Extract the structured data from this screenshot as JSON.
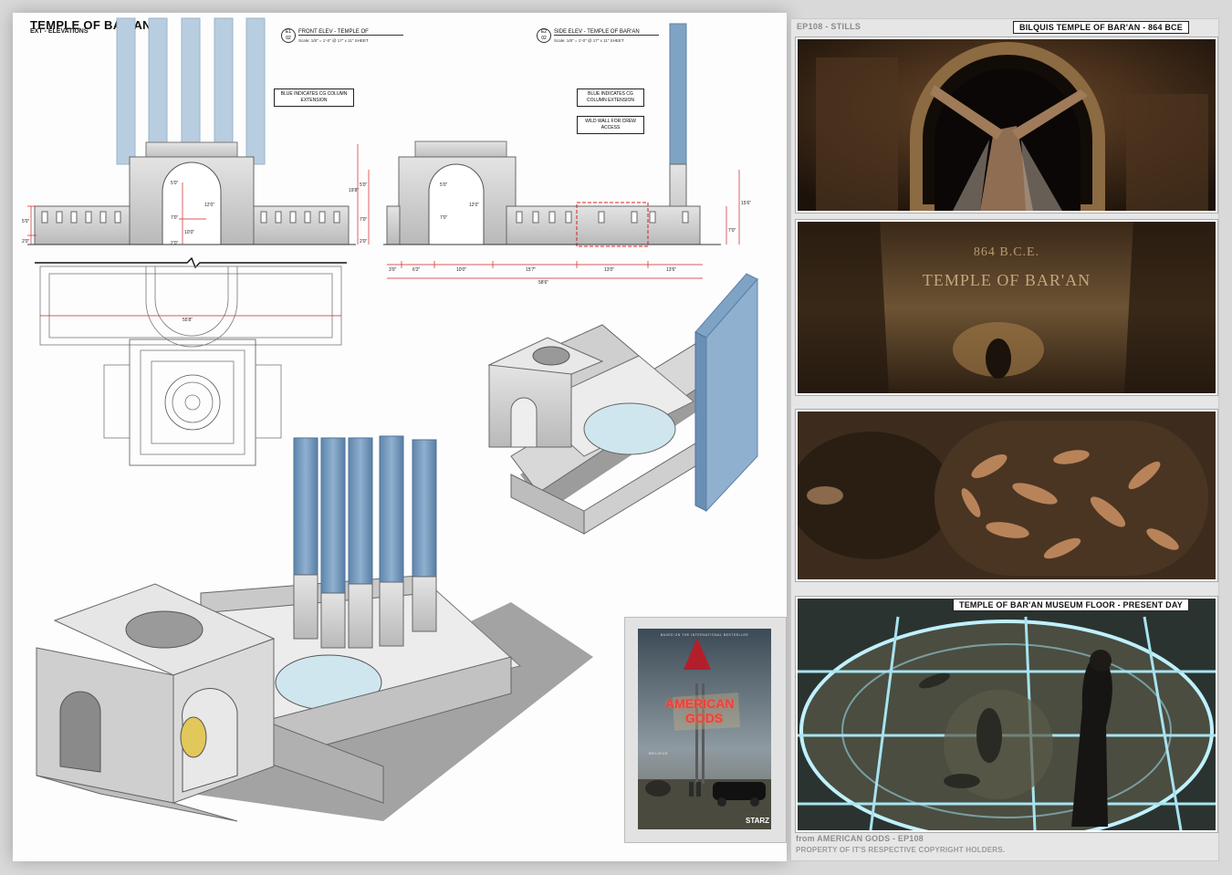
{
  "sheet": {
    "title": "TEMPLE OF BAR'AN",
    "subtitle": "EXT - ELEVATIONS",
    "front_tag": "E1",
    "front_tag_sheet": "02",
    "front_name": "FRONT ELEV - TEMPLE OF",
    "front_scale": "Scale: 1/8\" = 1'-0\" @ 17\" x 11\" SHEET",
    "side_tag": "E2",
    "side_tag_sheet": "02",
    "side_name": "SIDE ELEV - TEMPLE OF BAR'AN",
    "side_scale": "Scale: 1/8\" = 1'-0\" @ 17\" x 11\" SHEET",
    "callout_front": "BLUE INDICATES CG COLUMN EXTENSION",
    "callout_side": "BLUE INDICATES CG COLUMN EXTENSION",
    "callout_wild": "WILD WALL FOR CREW ACCESS",
    "dims_front": [
      "5'0\"",
      "2'0\"",
      "5'0\"",
      "7'0\"",
      "12'0\"",
      "10'0\"",
      "2'0\""
    ],
    "dims_side_v": [
      "19'8\"",
      "5'0\"",
      "7'0\"",
      "2'0\"",
      "5'0\"",
      "7'0\"",
      "12'0\"",
      "15'6\"",
      "7'0\""
    ],
    "dims_side_h": [
      "3'0\"",
      "6'2\"",
      "10'0\"",
      "15'7\"",
      "13'0\"",
      "13'6\""
    ],
    "dim_side_total": "58'6\"",
    "dim_plan": "55'8\"",
    "accent_blue": "#7fa3c4",
    "accent_red": "#d22222"
  },
  "stills_panel": {
    "header": "EP108 - STILLS",
    "label_top": "BILQUIS TEMPLE OF BAR'AN - 864 BCE",
    "label_bottom": "TEMPLE OF BAR'AN MUSEUM FLOOR - PRESENT DAY",
    "still2_text_date": "864 B.C.E.",
    "still2_text_name": "TEMPLE OF BAR'AN"
  },
  "poster": {
    "tagline_top": "BASED ON THE INTERNATIONAL BESTSELLER",
    "sign_line1": "AMERICAN",
    "sign_line2": "GODS",
    "believe": "BELIEVE",
    "network": "STARZ"
  },
  "caption": {
    "line1": "from AMERICAN GODS - EP108",
    "line2": "PROPERTY OF IT'S RESPECTIVE COPYRIGHT HOLDERS."
  }
}
